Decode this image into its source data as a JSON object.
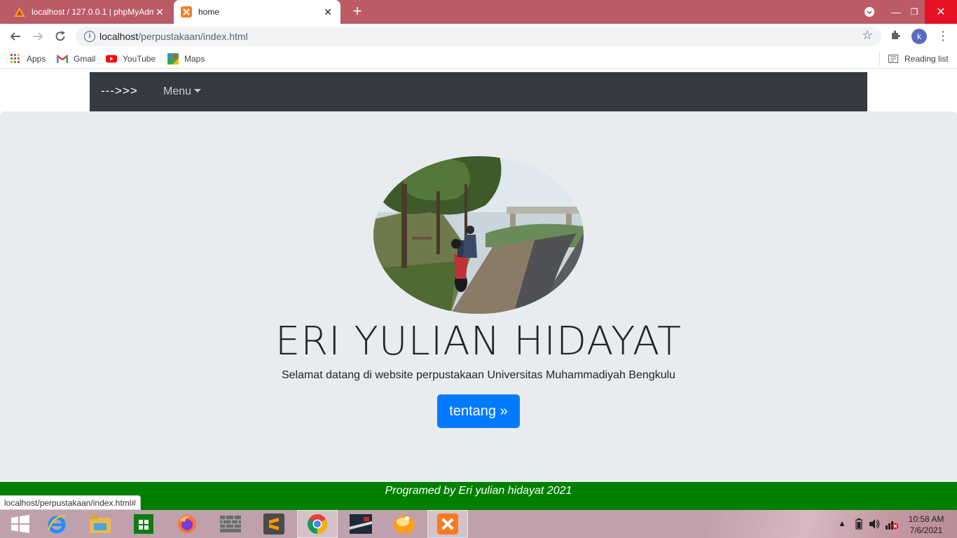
{
  "browser": {
    "tabs": [
      {
        "title": "localhost / 127.0.0.1 | phpMyAdmin",
        "favicon": "phpmyadmin-icon"
      },
      {
        "title": "home",
        "favicon": "xampp-icon"
      }
    ],
    "address": {
      "host": "localhost",
      "path": "/perpustakaan/index.html"
    },
    "bookmarks": [
      {
        "label": "Apps",
        "icon": "apps-grid-icon"
      },
      {
        "label": "Gmail",
        "icon": "gmail-icon"
      },
      {
        "label": "YouTube",
        "icon": "youtube-icon"
      },
      {
        "label": "Maps",
        "icon": "maps-icon"
      }
    ],
    "reading_list": "Reading list",
    "profile_initial": "k"
  },
  "page": {
    "navbar": {
      "brand": "--->>>",
      "menu": "Menu"
    },
    "hero": {
      "title": "ERI YULIAN HIDAYAT",
      "lead": "Selamat datang di website perpustakaan Universitas Muhammadiyah Bengkulu",
      "button": "tentang »"
    },
    "footer": "Programed by Eri yulian hidayat 2021",
    "status_url": "localhost/perpustakaan/index.html#"
  },
  "taskbar": {
    "apps": [
      "windows-start",
      "internet-explorer",
      "file-explorer",
      "microsoft-store",
      "firefox",
      "brick-app",
      "sublime-text",
      "chrome",
      "game-app",
      "media-app",
      "xampp"
    ],
    "time": "10:58 AM",
    "date": "7/6/2021"
  },
  "colors": {
    "tabstrip": "#bb5b66",
    "navbar": "#343a40",
    "jumbotron": "#e9ecef",
    "button": "#007bff",
    "footer": "#008000"
  }
}
